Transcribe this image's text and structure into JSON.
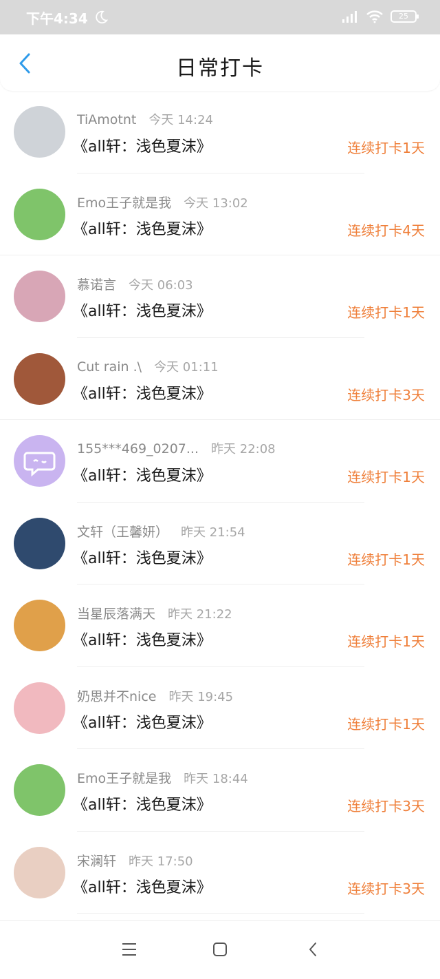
{
  "status_bar": {
    "time": "下午4:34",
    "battery": "25"
  },
  "header": {
    "title": "日常打卡"
  },
  "checkins": [
    {
      "user": "TiAmotnt",
      "time": "今天 14:24",
      "content": "《all轩：浅色夏沫》",
      "streak": "连续打卡1天",
      "avatar_color": "#cfd3d8"
    },
    {
      "user": "Emo王子就是我",
      "time": "今天 13:02",
      "content": "《all轩：浅色夏沫》",
      "streak": "连续打卡4天",
      "avatar_color": "#7fc46a"
    },
    {
      "user": "慕诺言",
      "time": "今天 06:03",
      "content": "《all轩：浅色夏沫》",
      "streak": "连续打卡1天",
      "avatar_color": "#d8a6b6"
    },
    {
      "user": "Cut rain .\\",
      "time": "今天 01:11",
      "content": "《all轩：浅色夏沫》",
      "streak": "连续打卡3天",
      "avatar_color": "#a0583a"
    },
    {
      "user": "155***469_0207...",
      "time": "昨天 22:08",
      "content": "《all轩：浅色夏沫》",
      "streak": "连续打卡1天",
      "avatar_color": "#c9b4f0"
    },
    {
      "user": "文轩（王馨妍）",
      "time": "昨天 21:54",
      "content": "《all轩：浅色夏沫》",
      "streak": "连续打卡1天",
      "avatar_color": "#2f4a6e"
    },
    {
      "user": "当星辰落满天",
      "time": "昨天 21:22",
      "content": "《all轩：浅色夏沫》",
      "streak": "连续打卡1天",
      "avatar_color": "#e0a04a"
    },
    {
      "user": "奶思并不nice",
      "time": "昨天 19:45",
      "content": "《all轩：浅色夏沫》",
      "streak": "连续打卡1天",
      "avatar_color": "#f1b9bf"
    },
    {
      "user": "Emo王子就是我",
      "time": "昨天 18:44",
      "content": "《all轩：浅色夏沫》",
      "streak": "连续打卡3天",
      "avatar_color": "#7fc46a"
    },
    {
      "user": "宋澜轩",
      "time": "昨天 17:50",
      "content": "《all轩：浅色夏沫》",
      "streak": "连续打卡3天",
      "avatar_color": "#e9cfc2"
    }
  ],
  "colors": {
    "accent_orange": "#ef7f3a",
    "back_blue": "#2f9bea"
  },
  "nav": {
    "icons": [
      "menu-icon",
      "home-square-icon",
      "back-triangle-icon"
    ]
  }
}
